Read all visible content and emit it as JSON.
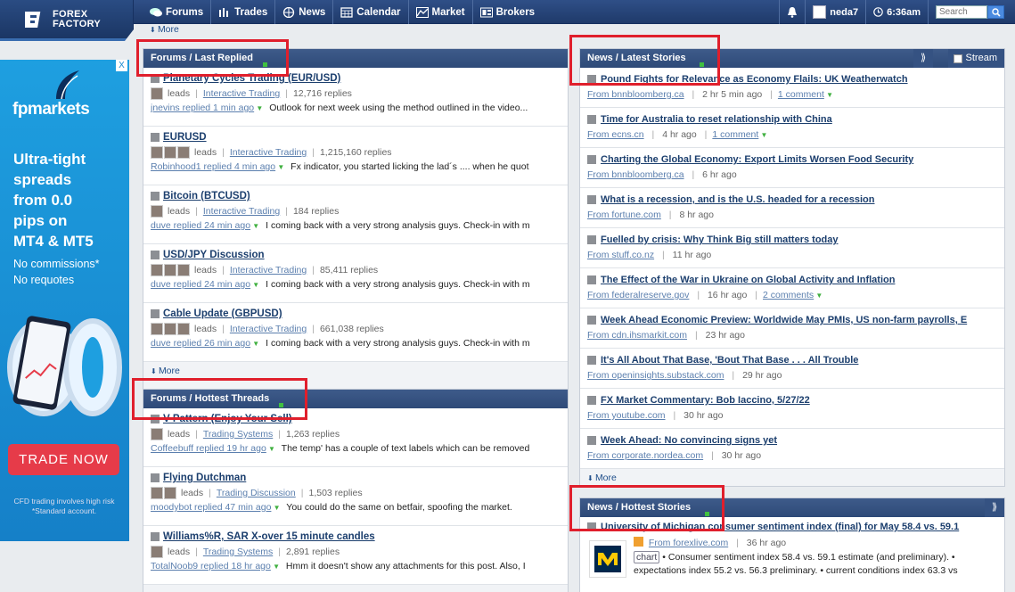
{
  "header": {
    "logo_line1": "FOREX",
    "logo_line2": "FACTORY",
    "nav": [
      {
        "label": "Forums",
        "icon": "forums-icon"
      },
      {
        "label": "Trades",
        "icon": "trades-icon"
      },
      {
        "label": "News",
        "icon": "globe-icon"
      },
      {
        "label": "Calendar",
        "icon": "calendar-icon"
      },
      {
        "label": "Market",
        "icon": "chart-icon"
      },
      {
        "label": "Brokers",
        "icon": "brokers-icon"
      }
    ],
    "username": "neda7",
    "time": "6:36am",
    "search_placeholder": "Search"
  },
  "ad": {
    "close": "X",
    "brand": "fpmarkets",
    "headline_lines": [
      "Ultra-tight",
      "spreads",
      "from 0.0",
      "pips on",
      "MT4 & MT5"
    ],
    "sub_lines": [
      "No commissions*",
      "No requotes"
    ],
    "cta": "TRADE NOW",
    "fine_lines": [
      "CFD trading involves high risk",
      "*Standard account."
    ]
  },
  "top_more": "More",
  "forums_last_replied": {
    "title": "Forums / Last Replied",
    "more": "More",
    "threads": [
      {
        "title": "Planetary Cycles Trading (EUR/USD)",
        "leads": "leads",
        "forum": "Interactive Trading",
        "replies": "12,716 replies",
        "who": "jnevins replied 1 min ago",
        "text": "Outlook for next week using the method outlined in the video...",
        "avatars": 1
      },
      {
        "title": "EURUSD",
        "leads": "leads",
        "forum": "Interactive Trading",
        "replies": "1,215,160 replies",
        "who": "Robinhood1 replied 4 min ago",
        "text": "Fx indicator, you started licking the lad´s .... when he quot",
        "avatars": 3
      },
      {
        "title": "Bitcoin (BTCUSD)",
        "leads": "leads",
        "forum": "Interactive Trading",
        "replies": "184 replies",
        "who": "duve replied 24 min ago",
        "text": "I coming back with a very strong analysis guys. Check-in with m",
        "avatars": 1
      },
      {
        "title": "USD/JPY Discussion",
        "leads": "leads",
        "forum": "Interactive Trading",
        "replies": "85,411 replies",
        "who": "duve replied 24 min ago",
        "text": "I coming back with a very strong analysis guys. Check-in with m",
        "avatars": 3
      },
      {
        "title": "Cable Update (GBPUSD)",
        "leads": "leads",
        "forum": "Interactive Trading",
        "replies": "661,038 replies",
        "who": "duve replied 26 min ago",
        "text": "I coming back with a very strong analysis guys. Check-in with m",
        "avatars": 3
      }
    ]
  },
  "forums_hottest": {
    "title": "Forums / Hottest Threads",
    "threads": [
      {
        "title": "V Pattern (Enjoy Your Sell)",
        "leads": "leads",
        "forum": "Trading Systems",
        "replies": "1,263 replies",
        "who": "Coffeebuff replied 19 hr ago",
        "text": "The temp' has a couple of text labels which can be removed",
        "avatars": 1
      },
      {
        "title": "Flying Dutchman",
        "leads": "leads",
        "forum": "Trading Discussion",
        "replies": "1,503 replies",
        "who": "moodybot replied 47 min ago",
        "text": "You could do the same on betfair, spoofing the market.",
        "avatars": 2
      },
      {
        "title": "Williams%R, SAR X-over 15 minute candles",
        "leads": "leads",
        "forum": "Trading Systems",
        "replies": "2,891 replies",
        "who": "TotalNoob9 replied 18 hr ago",
        "text": "Hmm it doesn't show any attachments for this post. Also, I",
        "avatars": 1
      }
    ]
  },
  "news_latest": {
    "title": "News / Latest Stories",
    "stream": "Stream",
    "more": "More",
    "stories": [
      {
        "title": "Pound Fights for Relevance as Economy Flails: UK Weatherwatch",
        "src": "From bnnbloomberg.ca",
        "age": "2 hr 5 min ago",
        "comments": "1 comment"
      },
      {
        "title": "Time for Australia to reset relationship with China",
        "src": "From ecns.cn",
        "age": "4 hr ago",
        "comments": "1 comment"
      },
      {
        "title": "Charting the Global Economy: Export Limits Worsen Food Security",
        "src": "From bnnbloomberg.ca",
        "age": "6 hr ago",
        "comments": ""
      },
      {
        "title": "What is a recession, and is the U.S. headed for a recession",
        "src": "From fortune.com",
        "age": "8 hr ago",
        "comments": ""
      },
      {
        "title": "Fuelled by crisis: Why Think Big still matters today",
        "src": "From stuff.co.nz",
        "age": "11 hr ago",
        "comments": ""
      },
      {
        "title": "The Effect of the War in Ukraine on Global Activity and Inflation",
        "src": "From federalreserve.gov",
        "age": "16 hr ago",
        "comments": "2 comments"
      },
      {
        "title": "Week Ahead Economic Preview: Worldwide May PMIs, US non-farm payrolls, E",
        "src": "From cdn.ihsmarkit.com",
        "age": "23 hr ago",
        "comments": ""
      },
      {
        "title": "It's All About That Base, 'Bout That Base . . . All Trouble",
        "src": "From openinsights.substack.com",
        "age": "29 hr ago",
        "comments": ""
      },
      {
        "title": "FX Market Commentary: Bob Iaccino, 5/27/22",
        "src": "From youtube.com",
        "age": "30 hr ago",
        "comments": ""
      },
      {
        "title": "Week Ahead: No convincing signs yet",
        "src": "From corporate.nordea.com",
        "age": "30 hr ago",
        "comments": ""
      }
    ]
  },
  "news_hottest": {
    "title": "News / Hottest Stories",
    "story": {
      "title": "University of Michigan consumer sentiment index (final) for May 58.4 vs. 59.1",
      "src": "From forexlive.com",
      "age": "36 hr ago",
      "chart_tag": "chart",
      "summary1": "• Consumer sentiment index 58.4 vs. 59.1 estimate (and preliminary). •",
      "summary2": "expectations index 55.2 vs. 56.3 preliminary. • current conditions index 63.3 vs"
    }
  },
  "colors": {
    "topbar": "#2f4f87",
    "panel_header": "#3e5b8a",
    "link": "#1c3f6e",
    "highlight_box": "#e01f2c",
    "ad_bg": "#1e9fe0",
    "cta": "#e63b49"
  }
}
